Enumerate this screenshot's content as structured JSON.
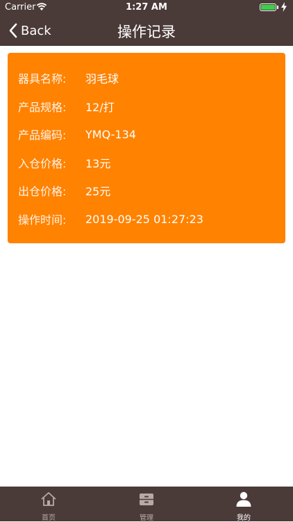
{
  "status": {
    "carrier": "Carrier",
    "time": "1:27 AM"
  },
  "nav": {
    "back_label": "Back",
    "title": "操作记录"
  },
  "record": {
    "rows": [
      {
        "label": "器具名称:",
        "value": "羽毛球"
      },
      {
        "label": "产品规格:",
        "value": "12/打"
      },
      {
        "label": "产品编码:",
        "value": "YMQ-134"
      },
      {
        "label": "入仓价格:",
        "value": "13元"
      },
      {
        "label": "出仓价格:",
        "value": "25元"
      },
      {
        "label": "操作时间:",
        "value": "2019-09-25 01:27:23"
      }
    ]
  },
  "tabbar": {
    "tabs": [
      {
        "label": "首页",
        "icon": "home-icon"
      },
      {
        "label": "管理",
        "icon": "cabinet-icon"
      },
      {
        "label": "我的",
        "icon": "user-icon",
        "active": true
      }
    ]
  },
  "colors": {
    "bar": "#4a3a38",
    "card": "#ff8200"
  }
}
